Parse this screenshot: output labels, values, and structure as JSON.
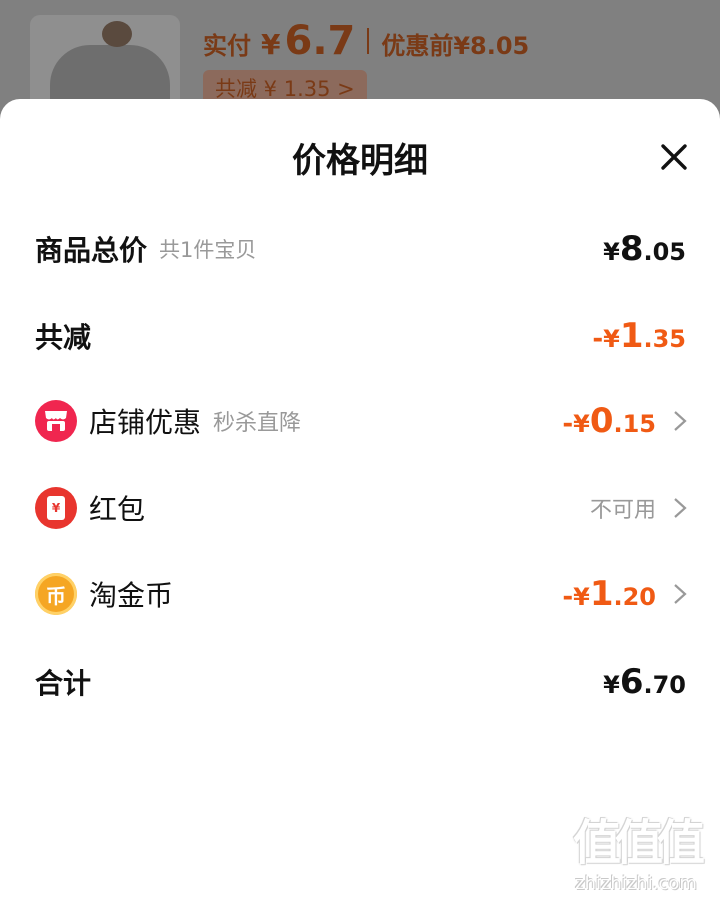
{
  "background": {
    "paid_label": "实付",
    "paid_yen": "¥",
    "paid_amount": "6.7",
    "original_label": "优惠前¥8.05",
    "discount_chip": "共减 ¥ 1.35 >"
  },
  "sheet": {
    "title": "价格明细",
    "close_icon": "close-icon"
  },
  "rows": {
    "subtotal": {
      "label": "商品总价",
      "sub": "共1件宝贝",
      "yen": "¥",
      "int": "8",
      "dec": ".05"
    },
    "discount_total": {
      "label": "共减",
      "sign": "-",
      "yen": "¥",
      "int": "1",
      "dec": ".35"
    },
    "store_discount": {
      "label": "店铺优惠",
      "sub": "秒杀直降",
      "icon": "store-icon",
      "sign": "-",
      "yen": "¥",
      "int": "0",
      "dec": ".15"
    },
    "red_packet": {
      "label": "红包",
      "icon": "red-packet-icon",
      "icon_text": "¥",
      "status": "不可用"
    },
    "taojinbi": {
      "label": "淘金币",
      "icon": "coin-icon",
      "icon_text": "币",
      "sign": "-",
      "yen": "¥",
      "int": "1",
      "dec": ".20"
    },
    "total": {
      "label": "合计",
      "yen": "¥",
      "int": "6",
      "dec": ".70"
    }
  },
  "colors": {
    "accent": "#f05a14",
    "store_icon_bg": "#f0264f",
    "red_packet_bg": "#e8352e",
    "coin_bg": "#f5a623",
    "muted": "#999999"
  },
  "watermark": {
    "logo": "值值值",
    "url": "zhizhizhi.com"
  }
}
